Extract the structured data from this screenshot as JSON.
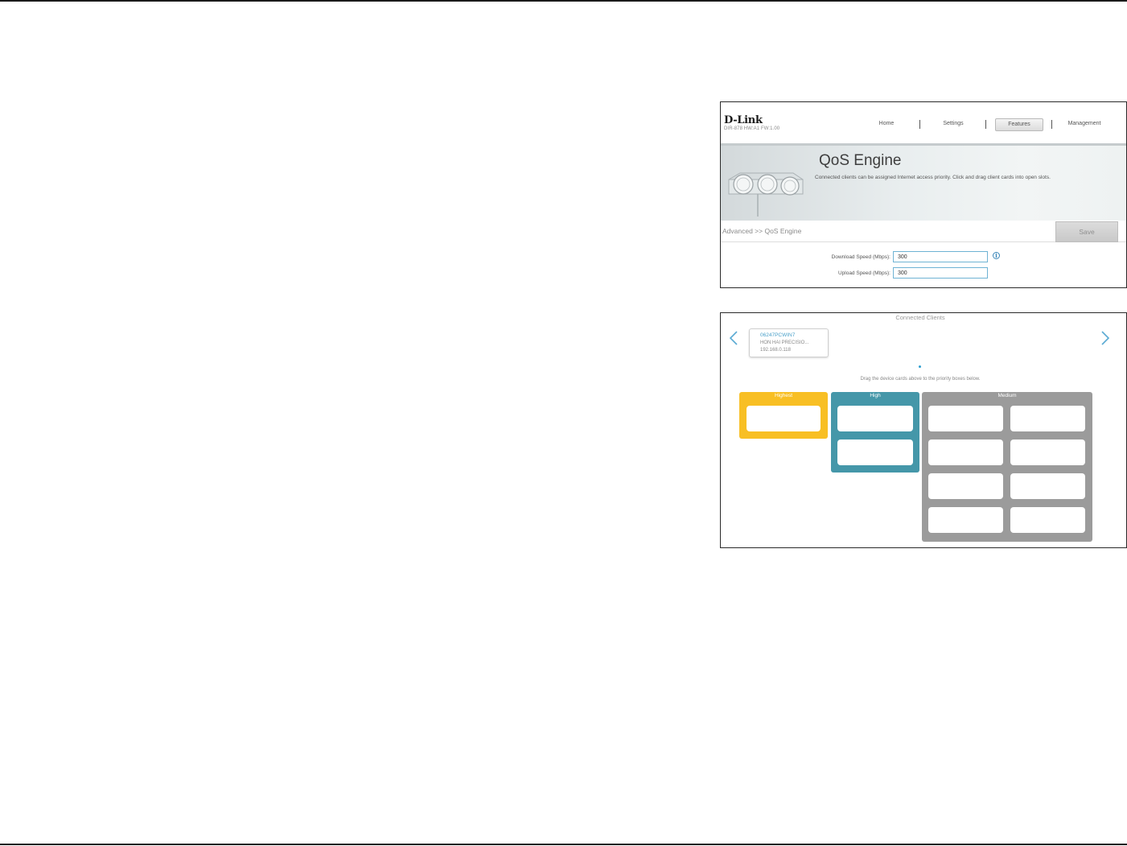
{
  "app": {
    "logo": "D-Link",
    "model": "DIR-878 HW:A1 FW:1.00"
  },
  "nav": {
    "items": [
      "Home",
      "Settings",
      "Features",
      "Management"
    ],
    "active": "Features"
  },
  "banner": {
    "title": "QoS Engine",
    "description": "Connected clients can be assigned Internet access priority. Click and drag client cards into open slots."
  },
  "breadcrumb": "Advanced >> QoS Engine",
  "save_label": "Save",
  "fields": {
    "download": {
      "label": "Download Speed (Mbps):",
      "value": "300"
    },
    "upload": {
      "label": "Upload Speed (Mbps):",
      "value": "300"
    }
  },
  "connected_clients": {
    "title": "Connected Clients",
    "client": {
      "name": "06247PCWIN7",
      "vendor": "HON HAI PRECISIO...",
      "ip": "192.168.0.118"
    },
    "drag_hint": "Drag the device cards above to the priority boxes below."
  },
  "priority": {
    "highest": "Highest",
    "high": "High",
    "medium": "Medium"
  },
  "colors": {
    "highest": "#f8bf24",
    "high": "#4597a9",
    "medium": "#9b9b9b",
    "accent": "#5aaad3"
  },
  "icons": {
    "info": "info-icon",
    "left": "chevron-left-icon",
    "right": "chevron-right-icon"
  }
}
